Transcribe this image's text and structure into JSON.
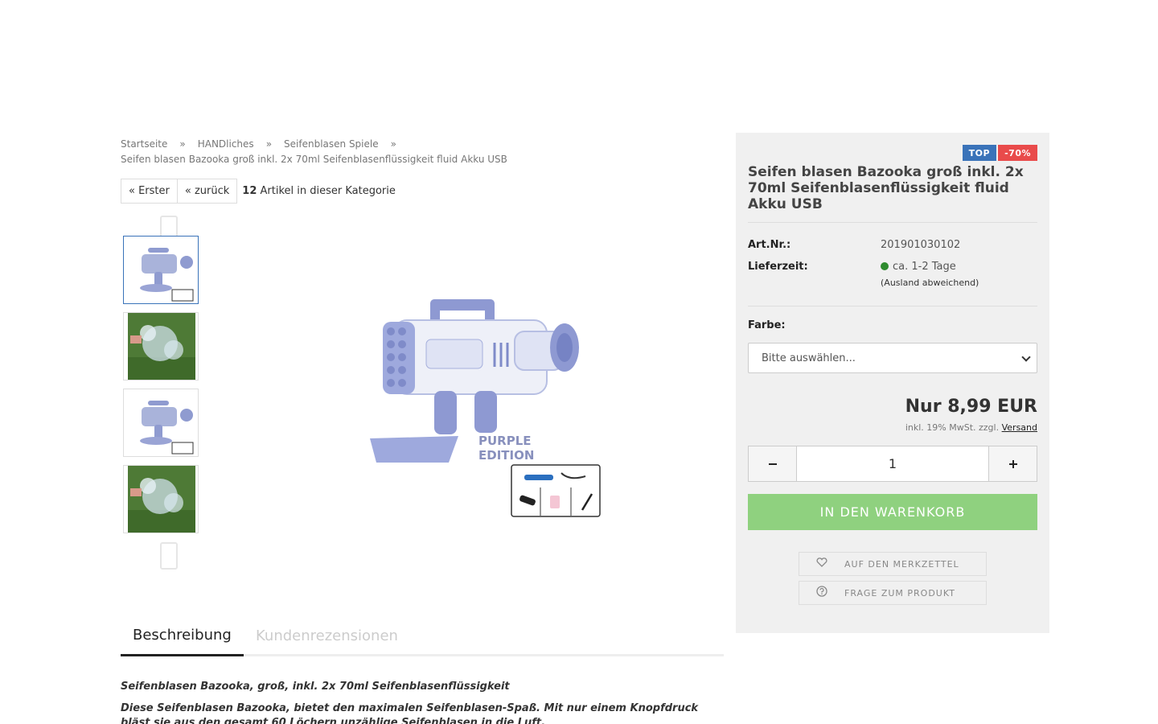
{
  "breadcrumb": {
    "items": [
      "Startseite",
      "HANDliches",
      "Seifenblasen Spiele"
    ],
    "current": "Seifen blasen Bazooka groß inkl. 2x 70ml Seifenblasenflüssigkeit fluid Akku USB",
    "separator": "»"
  },
  "pager": {
    "first": "« Erster",
    "back": "« zurück",
    "count": "12",
    "count_label": "Artikel in dieser Kategorie"
  },
  "gallery": {
    "up_icon": "chevron-up-icon",
    "down_icon": "chevron-down-icon",
    "main_caption": [
      "PURPLE",
      "EDITION"
    ]
  },
  "tabs": {
    "description": "Beschreibung",
    "reviews": "Kundenrezensionen"
  },
  "description": {
    "heading": "Seifenblasen Bazooka, groß, inkl. 2x 70ml Seifenblasenflüssigkeit",
    "text": "Diese Seifenblasen Bazooka, bietet den maximalen Seifenblasen-Spaß. Mit nur einem Knopfdruck bläst sie aus den gesamt 60 Löchern unzählige Seifenblasen in die Luft."
  },
  "buybox": {
    "badge_top": "TOP",
    "badge_sale": "-70%",
    "title": "Seifen blasen Bazooka groß inkl. 2x 70ml Seifenblasenflüssigkeit fluid Akku USB",
    "artnr_label": "Art.Nr.:",
    "artnr_value": "201901030102",
    "delivery_label": "Lieferzeit:",
    "delivery_value": "ca. 1-2 Tage",
    "delivery_note": "(Ausland abweichend)",
    "color_label": "Farbe:",
    "color_select": "Bitte auswählen...",
    "price": "Nur 8,99 EUR",
    "tax_text": "inkl. 19% MwSt. zzgl.",
    "shipping_link": "Versand",
    "qty_value": "1",
    "minus_icon": "minus-icon",
    "plus_icon": "plus-icon",
    "cart_button": "IN DEN WARENKORB",
    "wishlist_button": "AUF DEN MERKZETTEL",
    "question_button": "FRAGE ZUM PRODUKT",
    "colors": {
      "top": "#3a73b9",
      "sale": "#e94b4b",
      "cart": "#8fd17f",
      "delivery_dot": "#2e8b2e"
    }
  }
}
